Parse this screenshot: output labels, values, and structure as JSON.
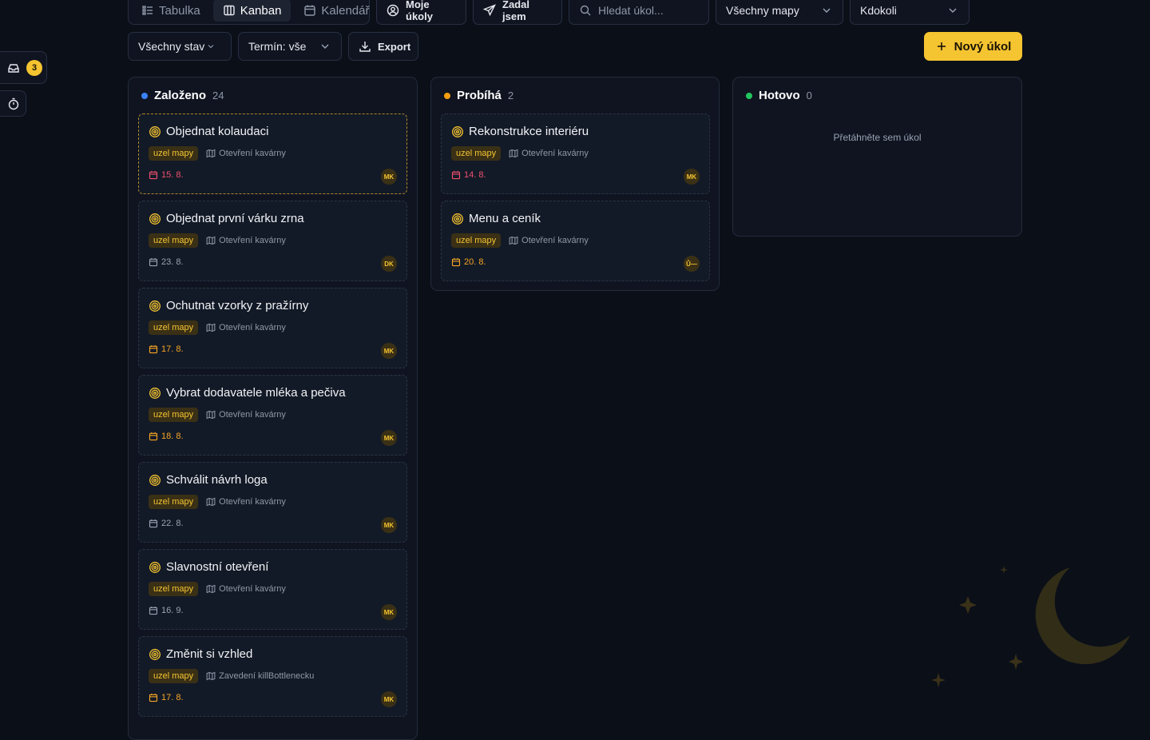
{
  "views": [
    {
      "label": "Tabulka",
      "icon": "list-icon",
      "active": false
    },
    {
      "label": "Kanban",
      "icon": "columns-icon",
      "active": true
    },
    {
      "label": "Kalendář",
      "icon": "calendar-icon",
      "active": false
    }
  ],
  "toolbar": {
    "my_tasks": "Moje úkoly",
    "assigned_by_me": "Zadal jsem",
    "search_placeholder": "Hledat úkol...",
    "maps_filter": "Všechny mapy",
    "assignee_filter": "Kdokoli",
    "status_filter": "Všechny stav",
    "deadline_filter": "Termín: vše",
    "export": "Export",
    "new_task": "Nový úkol"
  },
  "sidebar": {
    "inbox_count": "3"
  },
  "colors": {
    "accent": "#f5c431",
    "status_new": "#3b82f6",
    "status_progress": "#f59e0b",
    "status_done": "#22c55e",
    "date_overdue": "#f0506e",
    "date_normal": "#9aa3b5"
  },
  "columns": [
    {
      "title": "Založeno",
      "count": "24",
      "color": "#3b82f6",
      "cards": [
        {
          "title": "Objednat kolaudaci",
          "tag": "uzel mapy",
          "map": "Otevření kavárny",
          "date": "15. 8.",
          "date_color": "#f0506e",
          "assignee": "MK",
          "selected": true
        },
        {
          "title": "Objednat první várku zrna",
          "tag": "uzel mapy",
          "map": "Otevření kavárny",
          "date": "23. 8.",
          "date_color": "#9aa3b5",
          "assignee": "DK"
        },
        {
          "title": "Ochutnat vzorky z pražírny",
          "tag": "uzel mapy",
          "map": "Otevření kavárny",
          "date": "17. 8.",
          "date_color": "#f5a524",
          "assignee": "MK"
        },
        {
          "title": "Vybrat dodavatele mléka a pečiva",
          "tag": "uzel mapy",
          "map": "Otevření kavárny",
          "date": "18. 8.",
          "date_color": "#f5a524",
          "assignee": "MK"
        },
        {
          "title": "Schválit návrh loga",
          "tag": "uzel mapy",
          "map": "Otevření kavárny",
          "date": "22. 8.",
          "date_color": "#9aa3b5",
          "assignee": "MK"
        },
        {
          "title": "Slavnostní otevření",
          "tag": "uzel mapy",
          "map": "Otevření kavárny",
          "date": "16. 9.",
          "date_color": "#9aa3b5",
          "assignee": "MK"
        },
        {
          "title": "Změnit si vzhled",
          "tag": "uzel mapy",
          "map": "Zavedení killBottlenecku",
          "date": "17. 8.",
          "date_color": "#f5a524",
          "assignee": "MK"
        }
      ]
    },
    {
      "title": "Probíhá",
      "count": "2",
      "color": "#f59e0b",
      "cards": [
        {
          "title": "Rekonstrukce interiéru",
          "tag": "uzel mapy",
          "map": "Otevření kavárny",
          "date": "14. 8.",
          "date_color": "#f0506e",
          "assignee": "MK"
        },
        {
          "title": "Menu a ceník",
          "tag": "uzel mapy",
          "map": "Otevření kavárny",
          "date": "20. 8.",
          "date_color": "#f5a524",
          "assignee": "Ů—"
        }
      ]
    },
    {
      "title": "Hotovo",
      "count": "0",
      "color": "#22c55e",
      "empty_hint": "Přetáhněte sem úkol",
      "cards": []
    }
  ]
}
